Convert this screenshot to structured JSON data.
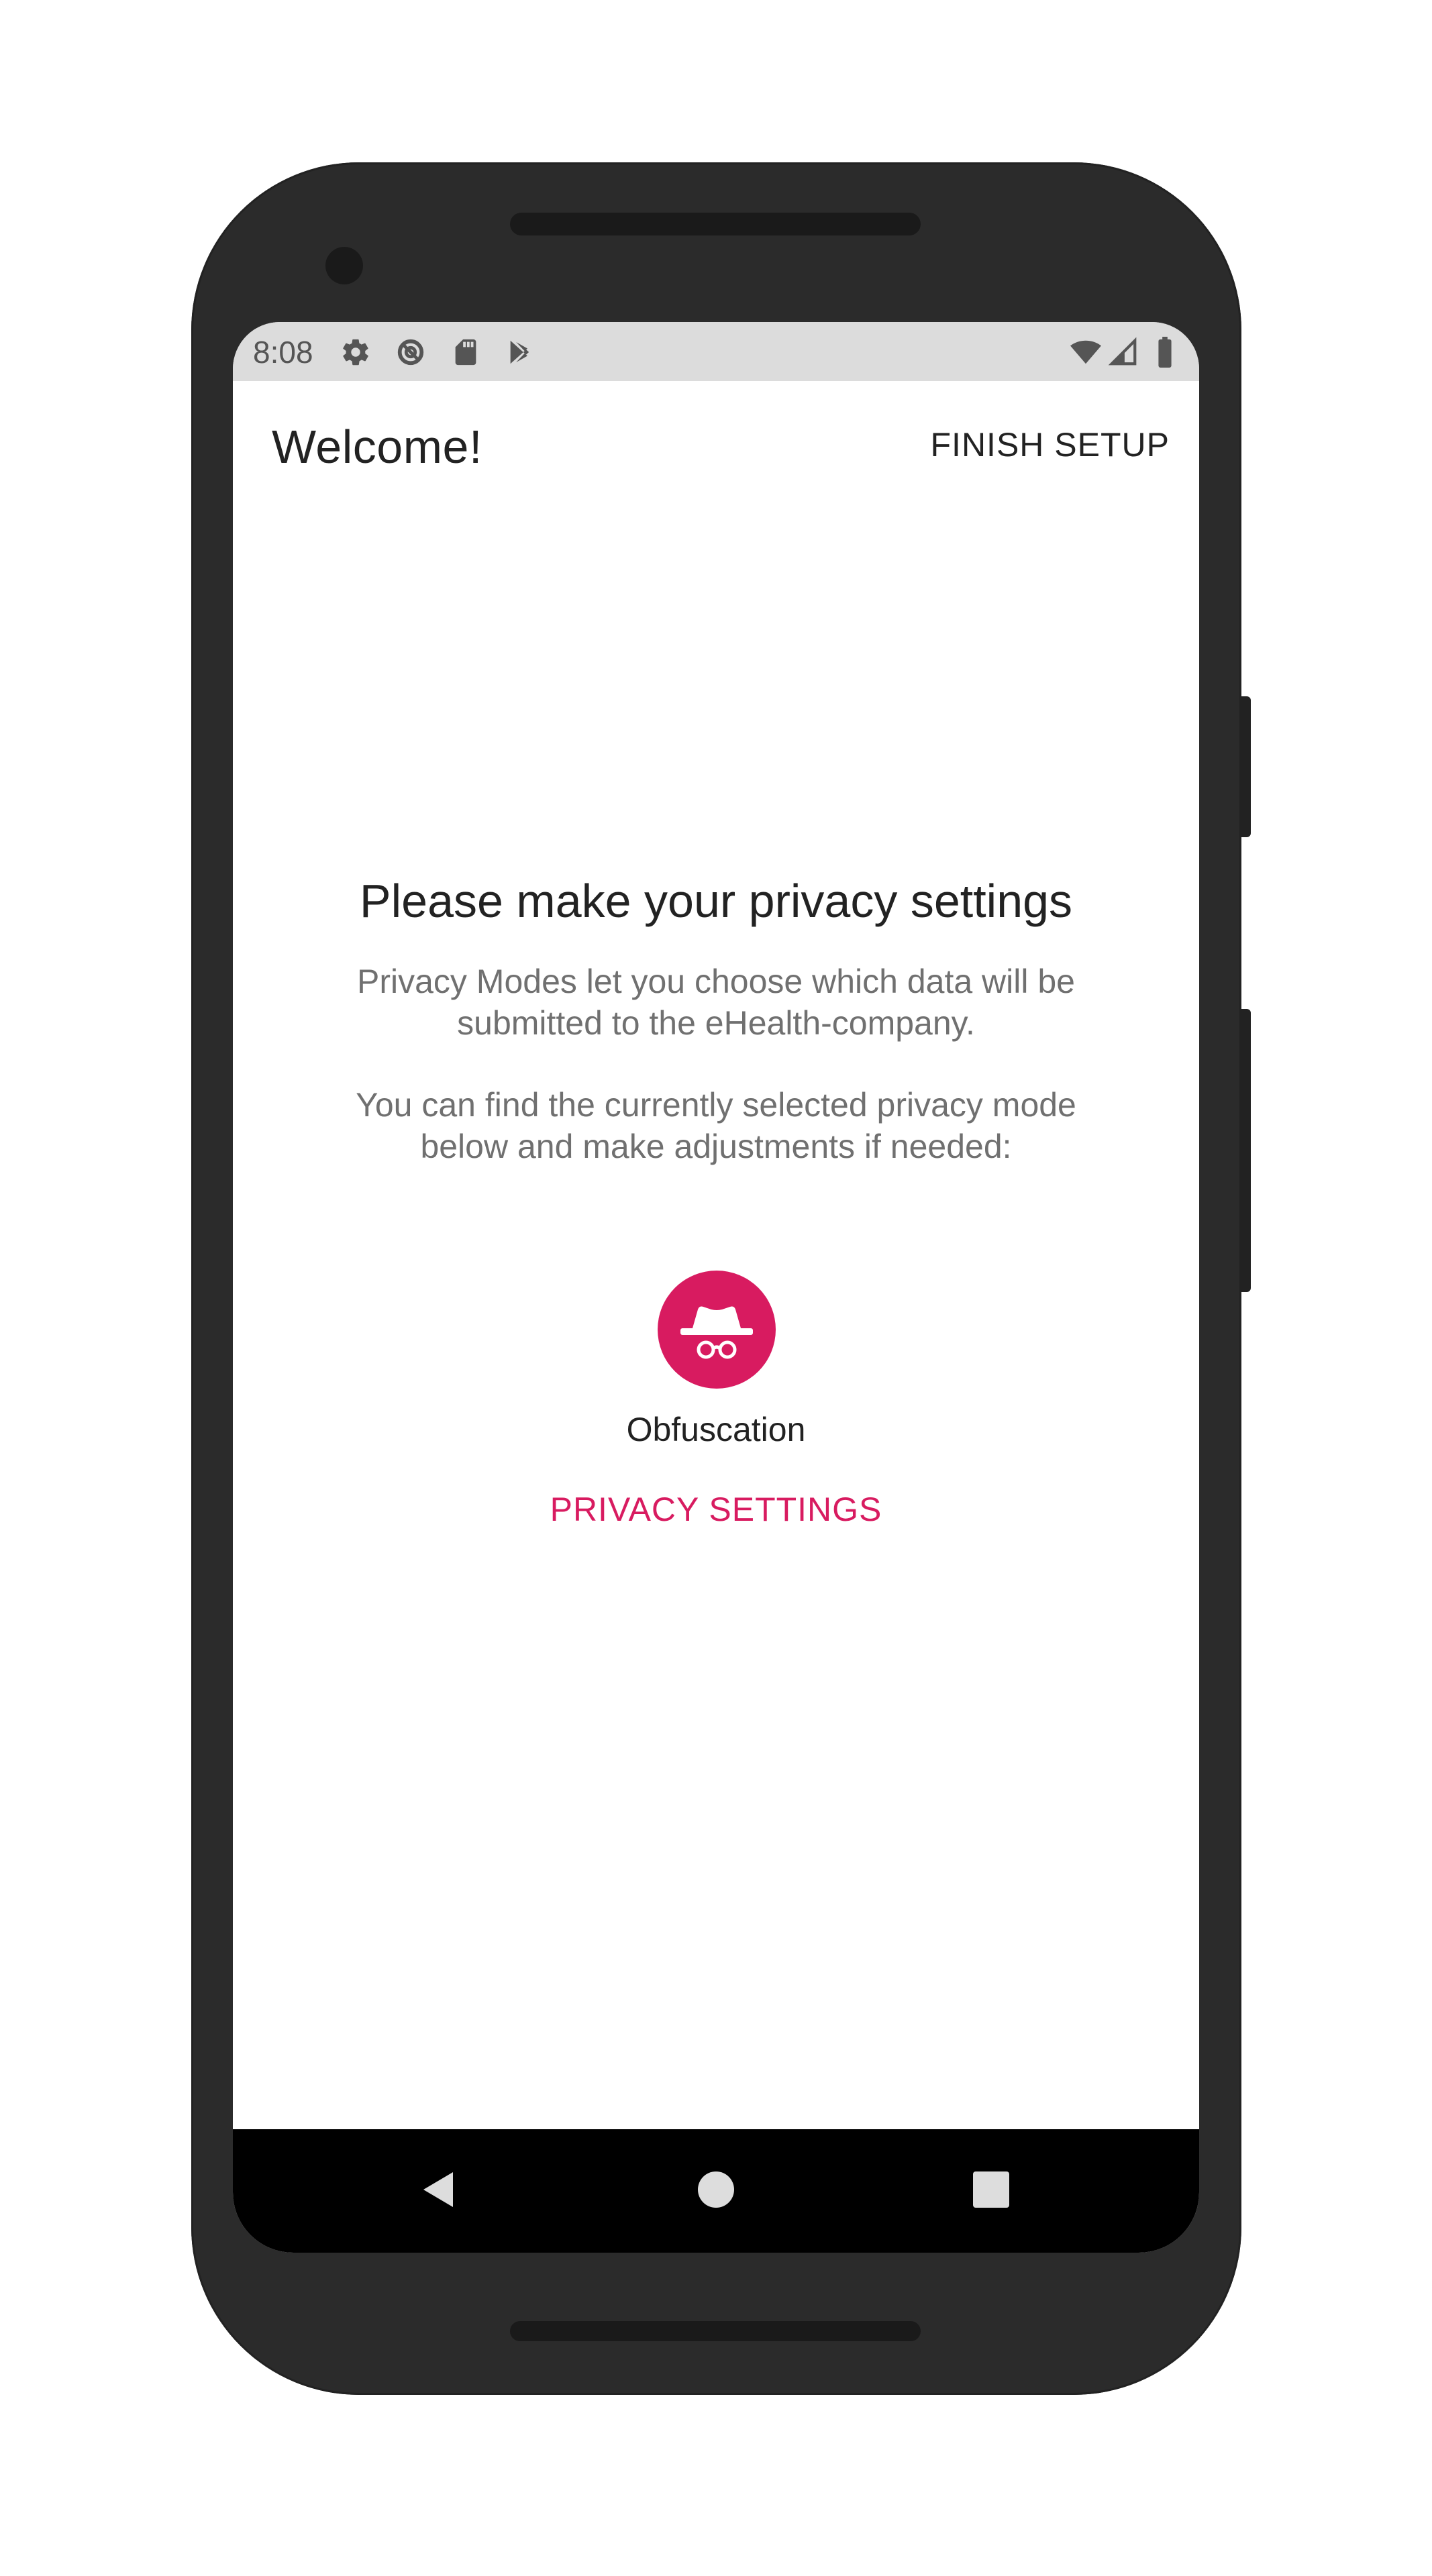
{
  "status_bar": {
    "time": "8:08",
    "left_icons": [
      "settings-icon",
      "data-saver-icon",
      "sd-card-icon",
      "play-store-icon"
    ],
    "right_icons": [
      "wifi-icon",
      "cell-signal-icon",
      "battery-icon"
    ]
  },
  "header": {
    "title": "Welcome!",
    "action_label": "FINISH SETUP"
  },
  "main": {
    "heading": "Please make your privacy settings",
    "description_1": "Privacy Modes let you choose which data will be submitted to the eHealth-company.",
    "description_2": "You can find the currently selected privacy mode below and make adjustments if needed:",
    "selected_mode": {
      "icon": "incognito-icon",
      "label": "Obfuscation"
    },
    "settings_button": "PRIVACY SETTINGS"
  },
  "nav_bar": {
    "buttons": [
      "back-icon",
      "home-icon",
      "recents-icon"
    ]
  },
  "colors": {
    "accent": "#d81b60",
    "status_bar_bg": "#dcdcdc",
    "device_frame": "#2b2b2b"
  }
}
